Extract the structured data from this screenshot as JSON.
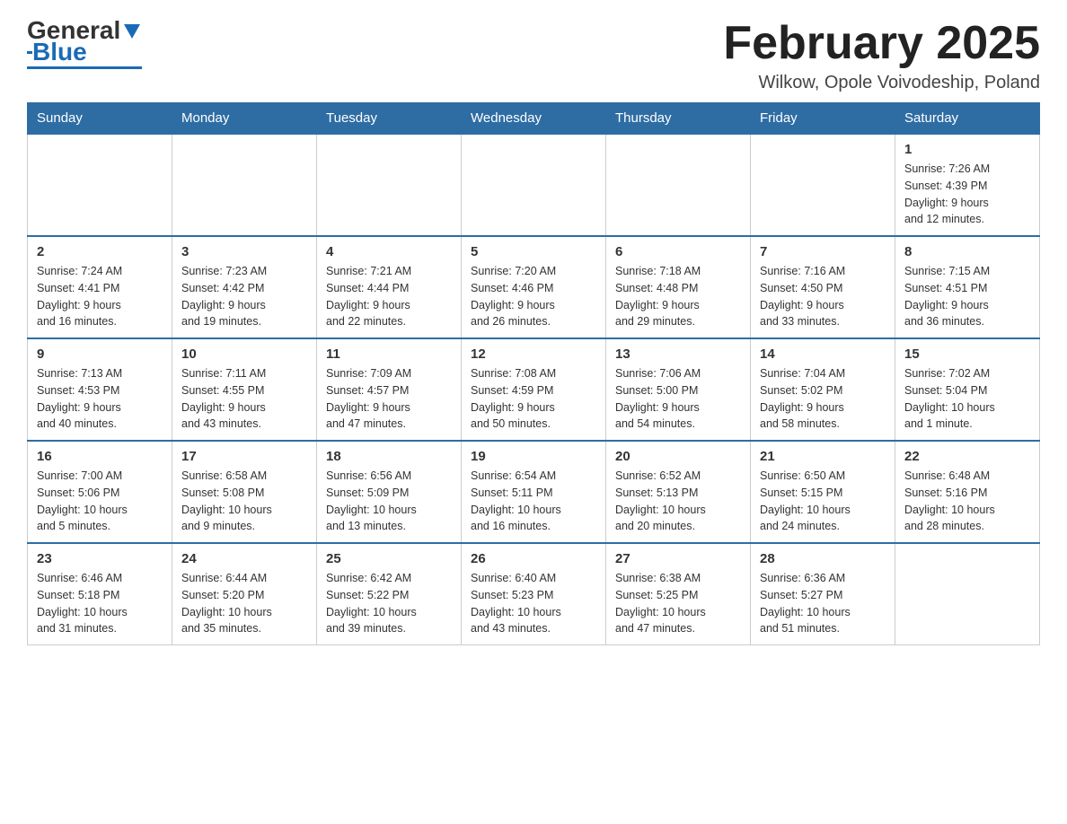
{
  "header": {
    "logo_general": "General",
    "logo_blue": "Blue",
    "month_title": "February 2025",
    "location": "Wilkow, Opole Voivodeship, Poland"
  },
  "weekdays": [
    "Sunday",
    "Monday",
    "Tuesday",
    "Wednesday",
    "Thursday",
    "Friday",
    "Saturday"
  ],
  "weeks": [
    [
      {
        "day": "",
        "info": ""
      },
      {
        "day": "",
        "info": ""
      },
      {
        "day": "",
        "info": ""
      },
      {
        "day": "",
        "info": ""
      },
      {
        "day": "",
        "info": ""
      },
      {
        "day": "",
        "info": ""
      },
      {
        "day": "1",
        "info": "Sunrise: 7:26 AM\nSunset: 4:39 PM\nDaylight: 9 hours\nand 12 minutes."
      }
    ],
    [
      {
        "day": "2",
        "info": "Sunrise: 7:24 AM\nSunset: 4:41 PM\nDaylight: 9 hours\nand 16 minutes."
      },
      {
        "day": "3",
        "info": "Sunrise: 7:23 AM\nSunset: 4:42 PM\nDaylight: 9 hours\nand 19 minutes."
      },
      {
        "day": "4",
        "info": "Sunrise: 7:21 AM\nSunset: 4:44 PM\nDaylight: 9 hours\nand 22 minutes."
      },
      {
        "day": "5",
        "info": "Sunrise: 7:20 AM\nSunset: 4:46 PM\nDaylight: 9 hours\nand 26 minutes."
      },
      {
        "day": "6",
        "info": "Sunrise: 7:18 AM\nSunset: 4:48 PM\nDaylight: 9 hours\nand 29 minutes."
      },
      {
        "day": "7",
        "info": "Sunrise: 7:16 AM\nSunset: 4:50 PM\nDaylight: 9 hours\nand 33 minutes."
      },
      {
        "day": "8",
        "info": "Sunrise: 7:15 AM\nSunset: 4:51 PM\nDaylight: 9 hours\nand 36 minutes."
      }
    ],
    [
      {
        "day": "9",
        "info": "Sunrise: 7:13 AM\nSunset: 4:53 PM\nDaylight: 9 hours\nand 40 minutes."
      },
      {
        "day": "10",
        "info": "Sunrise: 7:11 AM\nSunset: 4:55 PM\nDaylight: 9 hours\nand 43 minutes."
      },
      {
        "day": "11",
        "info": "Sunrise: 7:09 AM\nSunset: 4:57 PM\nDaylight: 9 hours\nand 47 minutes."
      },
      {
        "day": "12",
        "info": "Sunrise: 7:08 AM\nSunset: 4:59 PM\nDaylight: 9 hours\nand 50 minutes."
      },
      {
        "day": "13",
        "info": "Sunrise: 7:06 AM\nSunset: 5:00 PM\nDaylight: 9 hours\nand 54 minutes."
      },
      {
        "day": "14",
        "info": "Sunrise: 7:04 AM\nSunset: 5:02 PM\nDaylight: 9 hours\nand 58 minutes."
      },
      {
        "day": "15",
        "info": "Sunrise: 7:02 AM\nSunset: 5:04 PM\nDaylight: 10 hours\nand 1 minute."
      }
    ],
    [
      {
        "day": "16",
        "info": "Sunrise: 7:00 AM\nSunset: 5:06 PM\nDaylight: 10 hours\nand 5 minutes."
      },
      {
        "day": "17",
        "info": "Sunrise: 6:58 AM\nSunset: 5:08 PM\nDaylight: 10 hours\nand 9 minutes."
      },
      {
        "day": "18",
        "info": "Sunrise: 6:56 AM\nSunset: 5:09 PM\nDaylight: 10 hours\nand 13 minutes."
      },
      {
        "day": "19",
        "info": "Sunrise: 6:54 AM\nSunset: 5:11 PM\nDaylight: 10 hours\nand 16 minutes."
      },
      {
        "day": "20",
        "info": "Sunrise: 6:52 AM\nSunset: 5:13 PM\nDaylight: 10 hours\nand 20 minutes."
      },
      {
        "day": "21",
        "info": "Sunrise: 6:50 AM\nSunset: 5:15 PM\nDaylight: 10 hours\nand 24 minutes."
      },
      {
        "day": "22",
        "info": "Sunrise: 6:48 AM\nSunset: 5:16 PM\nDaylight: 10 hours\nand 28 minutes."
      }
    ],
    [
      {
        "day": "23",
        "info": "Sunrise: 6:46 AM\nSunset: 5:18 PM\nDaylight: 10 hours\nand 31 minutes."
      },
      {
        "day": "24",
        "info": "Sunrise: 6:44 AM\nSunset: 5:20 PM\nDaylight: 10 hours\nand 35 minutes."
      },
      {
        "day": "25",
        "info": "Sunrise: 6:42 AM\nSunset: 5:22 PM\nDaylight: 10 hours\nand 39 minutes."
      },
      {
        "day": "26",
        "info": "Sunrise: 6:40 AM\nSunset: 5:23 PM\nDaylight: 10 hours\nand 43 minutes."
      },
      {
        "day": "27",
        "info": "Sunrise: 6:38 AM\nSunset: 5:25 PM\nDaylight: 10 hours\nand 47 minutes."
      },
      {
        "day": "28",
        "info": "Sunrise: 6:36 AM\nSunset: 5:27 PM\nDaylight: 10 hours\nand 51 minutes."
      },
      {
        "day": "",
        "info": ""
      }
    ]
  ]
}
